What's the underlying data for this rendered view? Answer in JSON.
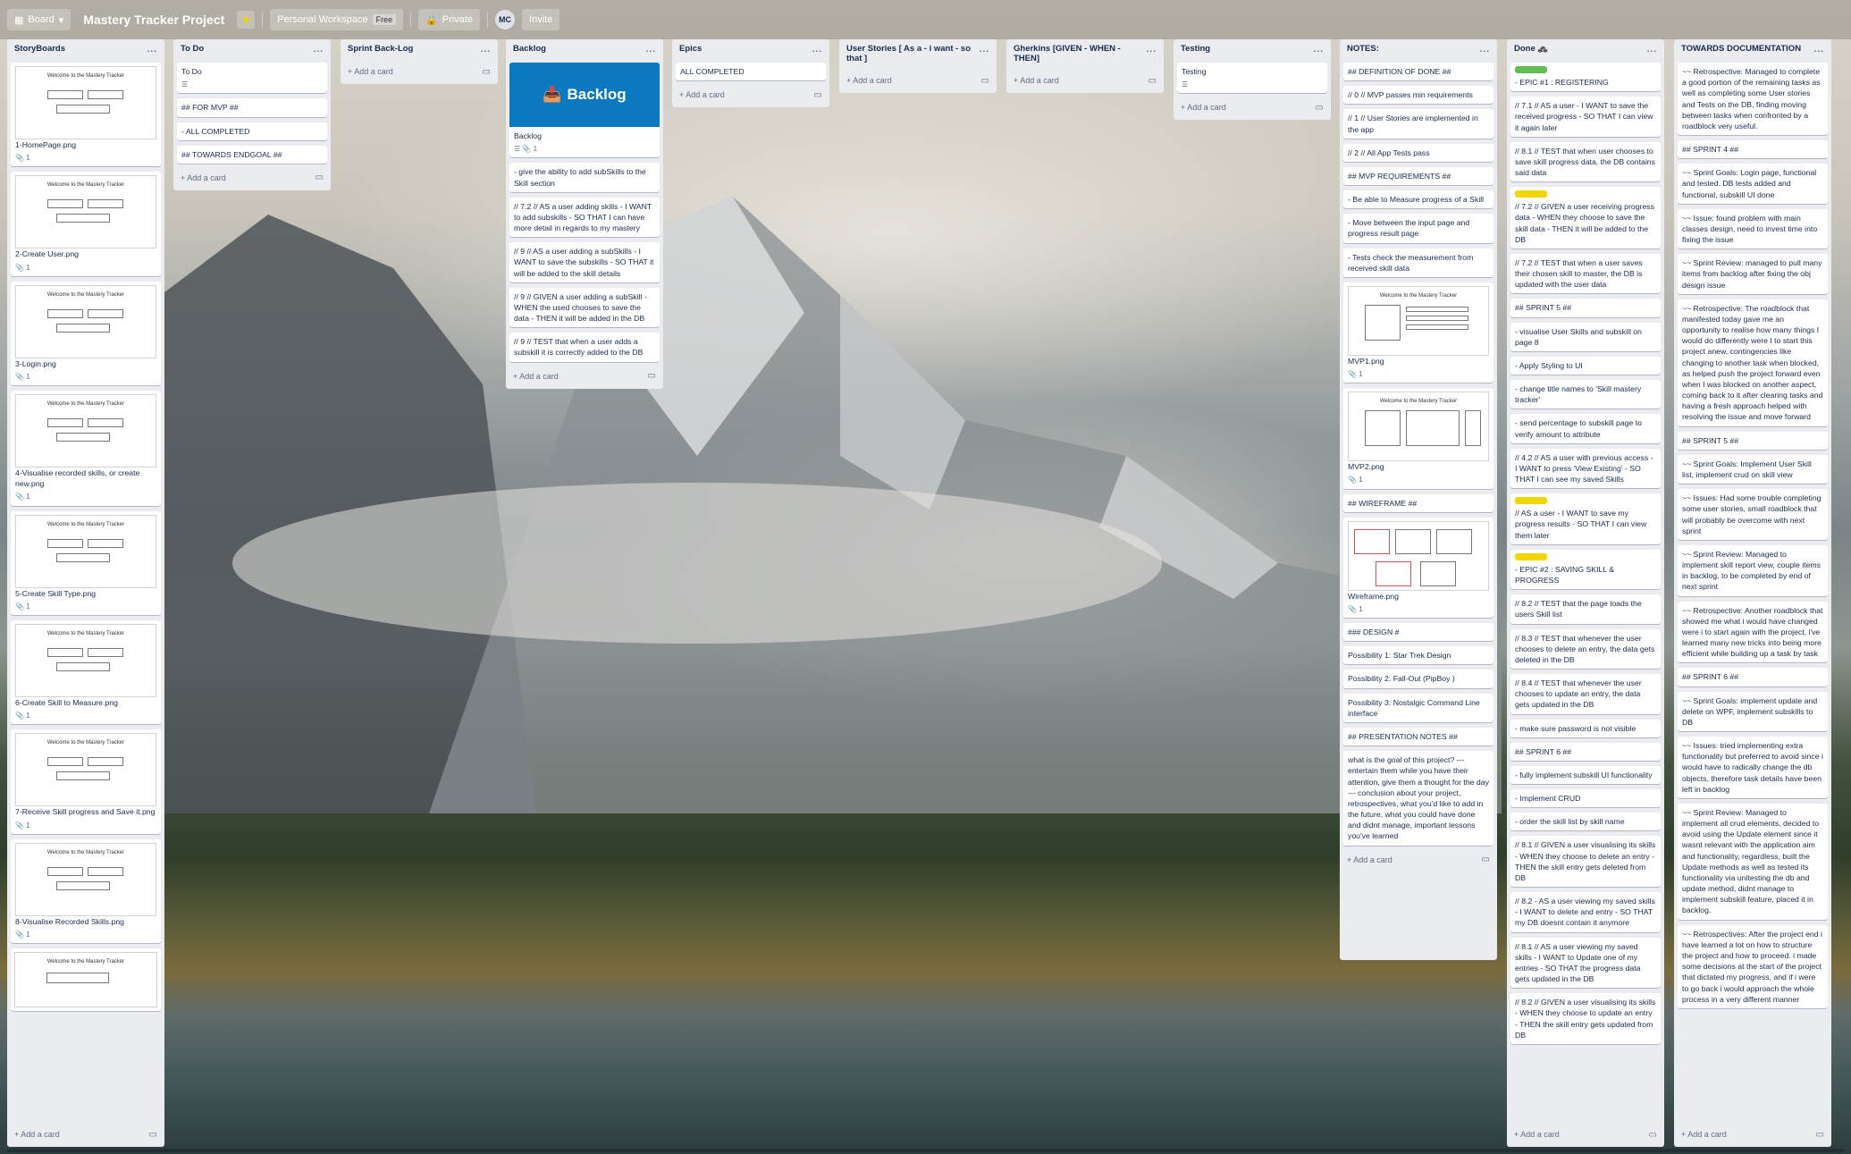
{
  "topbar": {
    "board_menu": "Board",
    "board_title": "Mastery Tracker Project",
    "workspace": "Personal Workspace",
    "workspace_badge": "Free",
    "visibility": "Private",
    "avatar_initials": "MC",
    "invite": "Invite"
  },
  "common": {
    "add_card": "+ Add a card",
    "menu": "..."
  },
  "lists": {
    "storyboards": {
      "title": "StoryBoards",
      "cards": [
        {
          "title": "1-HomePage.png",
          "count": "1"
        },
        {
          "title": "2-Create User.png",
          "count": "1"
        },
        {
          "title": "3-Login.png",
          "count": "1"
        },
        {
          "title": "4-Visualise recorded skills, or create new.png",
          "count": "1"
        },
        {
          "title": "5-Create Skill Type.png",
          "count": "1"
        },
        {
          "title": "6-Create Skill to Measure.png",
          "count": "1"
        },
        {
          "title": "7-Receive Skill progress and Save it.png",
          "count": "1"
        },
        {
          "title": "8-Visualise Recorded Skills.png",
          "count": "1"
        }
      ]
    },
    "todo": {
      "title": "To Do",
      "cards": [
        "To Do",
        "## FOR MVP ##",
        "- ALL COMPLETED",
        "## TOWARDS ENDGOAL ##"
      ]
    },
    "sprint": {
      "title": "Sprint Back-Log"
    },
    "backlog": {
      "title": "Backlog",
      "cover_text": "Backlog",
      "cover_card_title": "Backlog",
      "cover_card_count": "1",
      "cards": [
        "- give the ability to add subSkills to the Skill section",
        "// 7.2 // AS a user adding skills - I WANT to add subskills - SO THAT I can have more detail in regards to my mastery",
        "// 9 // AS a user adding a subSkills - I WANT to save the subskills - SO THAT it will be added to the skill details",
        "// 9 // GIVEN a user adding a subSkill - WHEN the used chooses to save the data - THEN it will be added in the DB",
        "// 9 // TEST that when a user adds a subskill it is correctly added to the DB"
      ]
    },
    "epics": {
      "title": "Epics",
      "cards": [
        "ALL COMPLETED"
      ]
    },
    "userstories": {
      "title": "User Stories [ As a - i want - so that ]"
    },
    "gherkins": {
      "title": "Gherkins [GIVEN - WHEN - THEN]"
    },
    "testing": {
      "title": "Testing",
      "cards": [
        "Testing"
      ]
    },
    "notes": {
      "title": "NOTES:",
      "cards": [
        "## DEFINITION OF DONE ##",
        "// 0 // MVP passes min requirements",
        "// 1 // User Stories are implemented in the app",
        "// 2 // All App Tests pass",
        "## MVP REQUIREMENTS ##",
        "- Be able to Measure progress of a Skill",
        "- Move between the input page and progress result page",
        "- Tests check the measurement from received skill data"
      ],
      "img1": {
        "title": "MVP1.png",
        "count": "1"
      },
      "img2": {
        "title": "MVP2.png",
        "count": "1"
      },
      "wireframe_header": "## WIREFRAME ##",
      "img3": {
        "title": "Wireframe.png",
        "count": "1"
      },
      "cards2": [
        "### DESIGN #",
        "Possibility 1: Star Trek Design",
        "Possibility 2: Fall-Out (PipBoy )",
        "Possibility 3: Nostalgic Command Line interface",
        "## PRESENTATION NOTES ##",
        "what is the goal of this project? --- entertain them while you have their attention, give them a thought for the day --- conclusion about your project, retrospectives, what you'd like to add in the future, what you could have done and didnt manage, important lessons you've learned"
      ]
    },
    "done": {
      "title": "Done 🚓",
      "cards": [
        {
          "label": "#61bd4f",
          "text": "- EPIC #1 : REGISTERING"
        },
        {
          "label": "",
          "text": "// 7.1 // AS a user - I WANT to save the received progress - SO THAT I can view it again later"
        },
        {
          "label": "",
          "text": "// 8.1 // TEST that when user chooses to save skill progress data, the DB contains said data"
        },
        {
          "label": "#f2d600",
          "text": "// 7.2 // GIVEN a user receiving progress data - WHEN they choose to save the skill data - THEN it will be added to the DB"
        },
        {
          "label": "",
          "text": "// 7.2 // TEST that when a user saves their chosen skill to master, the DB is updated with the user data"
        },
        {
          "label": "",
          "text": "## SPRINT 5 ##"
        },
        {
          "label": "",
          "text": "- visualise User Skills and subskill on page 8"
        },
        {
          "label": "",
          "text": "- Apply Styling to UI"
        },
        {
          "label": "",
          "text": "- change title names to 'Skill mastery tracker'"
        },
        {
          "label": "",
          "text": "- send percentage to subskill page to verify amount to attribute"
        },
        {
          "label": "",
          "text": "// 4.2 // AS a user with previous access - I WANT to press 'View Existing' - SO THAT I can see my saved Skills"
        },
        {
          "label": "#f2d600",
          "text": "// AS a user - I WANT to save my progress results - SO THAT I can view them later"
        },
        {
          "label": "#f2d600",
          "text": "- EPIC #2 : SAVING SKILL & PROGRESS"
        },
        {
          "label": "",
          "text": "// 8.2 // TEST that the page loads the users Skill list"
        },
        {
          "label": "",
          "text": "// 8.3 // TEST that whenever the user chooses to delete an entry, the data gets deleted in the DB"
        },
        {
          "label": "",
          "text": "// 8.4 // TEST that whenever the user chooses to update an entry, the data gets updated in the DB"
        },
        {
          "label": "",
          "text": "- make sure password is not visible"
        },
        {
          "label": "",
          "text": "## SPRINT 6 ##"
        },
        {
          "label": "",
          "text": "- fully implement subskill UI functionality"
        },
        {
          "label": "",
          "text": "- Implement CRUD"
        },
        {
          "label": "",
          "text": "- order the skill list by skill name"
        },
        {
          "label": "",
          "text": "// 8.1 // GIVEN a user visualising its skills - WHEN they choose to delete an entry - THEN the skill entry gets deleted from DB"
        },
        {
          "label": "",
          "text": "// 8.2 - AS a user viewing my saved skills - I WANT to delete and entry - SO THAT my DB doesnt contain it anymore"
        },
        {
          "label": "",
          "text": "// 8.1 // AS a user viewing my saved skills - I WANT to Update one of my entries - SO THAT the progress data gets updated in the DB"
        },
        {
          "label": "",
          "text": "// 8.2 // GIVEN a user visualising its skills - WHEN they choose to update an entry - THEN the skill entry gets updated from DB"
        }
      ]
    },
    "docs": {
      "title": "TOWARDS DOCUMENTATION",
      "cards": [
        "~~ Retrospective: Managed to complete a good portion of the remaining tasks as well as completing some User stories and Tests on the DB, finding moving between tasks when confronted by a roadblock very useful.",
        "## SPRINT 4 ##",
        "~~ Sprint Goals: Login page, functional and tested. DB tests added and functional, subskill UI done",
        "~~ Issue: found problem with main classes design, need to invest time into fixing the issue",
        "~~ Sprint Review: managed to pull many items from backlog after fixing the obj design issue",
        "~~ Retrospective: The roadblock that manifested today gave me an opportunity to realise how many things I would do differently were I to start this project anew, contingencies like changing to another task when blocked, as helped push the project forward even when I was blocked on another aspect, coming back to it after clearing tasks and having a fresh approach helped with resolving the issue and move forward",
        "## SPRINT 5 ##",
        "~~ Sprint Goals: Implement User Skill list, implement crud on skill view",
        "~~ Issues: Had some trouble completing some user stories, small roadblock that will probably be overcome with next sprint",
        "~~ Sprint Review: Managed to implement skill report view, couple items in backlog, to be completed by end of next sprint",
        "~~ Retrospective: Another roadblock that showed me what i would have changed were i to start again with the project, i've learned many new tricks into being more efficient while building up a task by task",
        "## SPRINT 6 ##",
        "~~ Sprint Goals: implement update and delete on WPF, implement subskills to DB",
        "~~ Issues: tried implementing extra functionality but preferred to avoid since i would have to radically change the db objects, therefore task details have been left in backlog",
        "~~ Sprint Review: Managed to implement all crud elements, decided to avoid using the Update element since it wasnt relevant with the application aim and functionality, regardless, built the Update methods as well as tested its functionality via unitesting the db and update method, didnt manage to implement subskill feature, placed it in backlog.",
        "~~ Retrospectives: After the project end i have learned a lot on how to structure the project and how to proceed. i made some decisions at the start of the project that dictated my progress, and if i were to go back i would approach the whole process in a very different manner"
      ]
    }
  },
  "colors": {
    "list_bg": "#ebecf0",
    "cover_blue": "#0a79bf",
    "green_label": "#61bd4f",
    "yellow_label": "#f2d600"
  }
}
